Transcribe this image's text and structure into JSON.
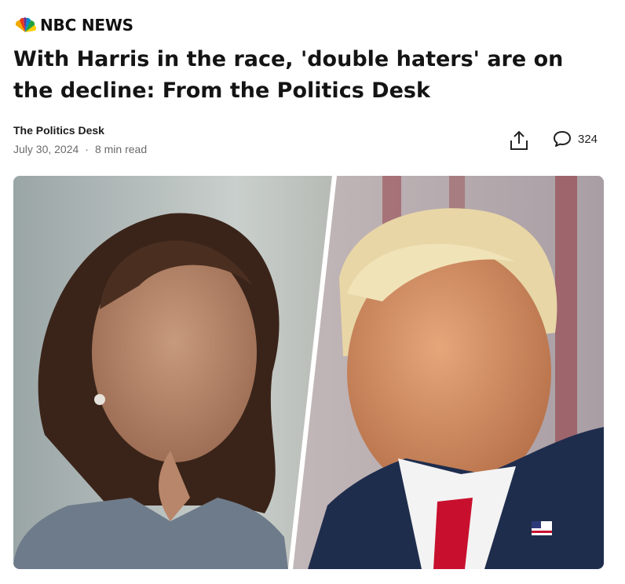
{
  "brand": {
    "name": "NBC NEWS",
    "logo_icon": "peacock-icon"
  },
  "article": {
    "headline": "With Harris in the race, 'double haters' are on the decline: From the Politics Desk",
    "author": "The Politics Desk",
    "date": "July 30, 2024",
    "separator": "·",
    "read_time": "8 min read"
  },
  "actions": {
    "share_icon": "share-icon",
    "comment_icon": "comment-icon",
    "comment_count": "324"
  },
  "image": {
    "description_icon": "hero-photo"
  },
  "colors": {
    "peacock": [
      "#f2a900",
      "#e8391e",
      "#6e2f8c",
      "#0089cf",
      "#22a13a",
      "#ffcc00"
    ],
    "tie": "#c8102e",
    "suit": "#1f2d4d"
  }
}
